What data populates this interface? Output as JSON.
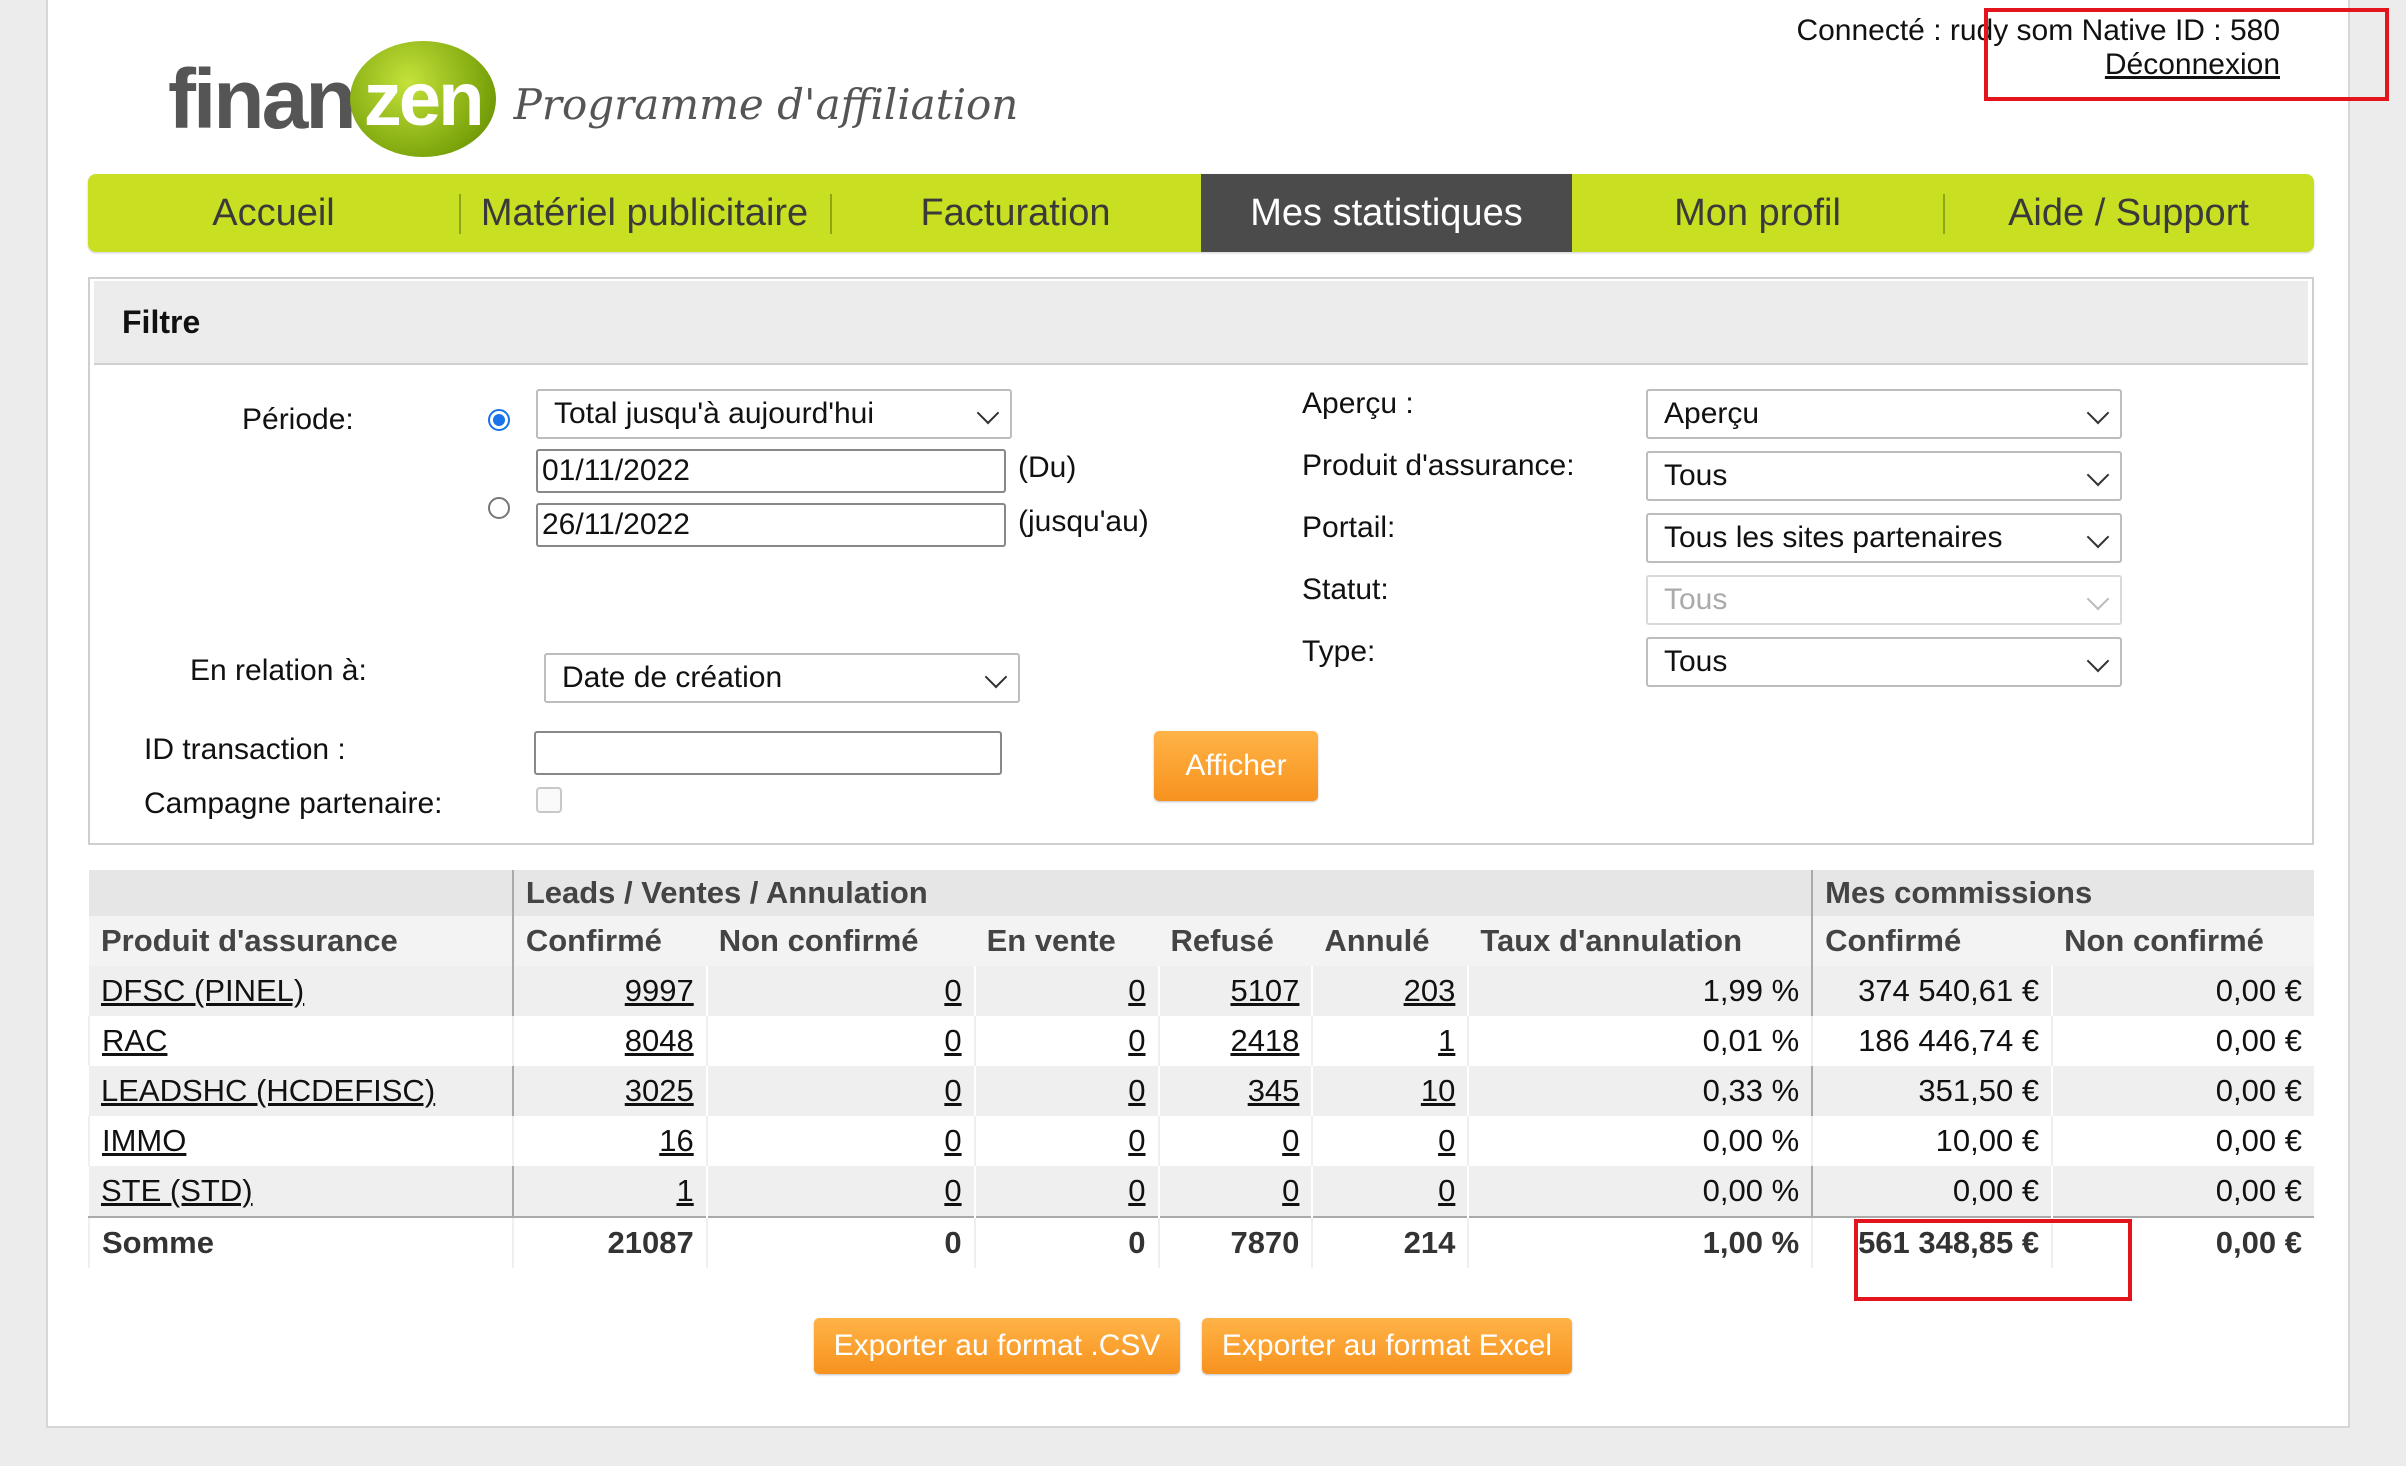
{
  "header": {
    "logo_finan": "finan",
    "logo_zen": "zen",
    "logo_subtitle": "Programme d'affiliation",
    "user_line": "Connecté : rudy som Native ID : 580",
    "logout": "Déconnexion"
  },
  "nav": {
    "items": [
      {
        "label": "Accueil"
      },
      {
        "label": "Matériel publicitaire"
      },
      {
        "label": "Facturation"
      },
      {
        "label": "Mes statistiques"
      },
      {
        "label": "Mon profil"
      },
      {
        "label": "Aide / Support"
      }
    ],
    "active_index": 3
  },
  "filter": {
    "title": "Filtre",
    "periode_label": "Période:",
    "periode_select": "Total jusqu'à aujourd'hui",
    "date_from": "01/11/2022",
    "date_from_suffix": "(Du)",
    "date_to": "26/11/2022",
    "date_to_suffix": "(jusqu'au)",
    "relation_label": "En relation à:",
    "relation_select": "Date de création",
    "transaction_label": "ID transaction :",
    "transaction_value": "",
    "campagne_label": "Campagne partenaire:",
    "apercu_label": "Aperçu :",
    "apercu_select": "Aperçu",
    "produit_label": "Produit d'assurance:",
    "produit_select": "Tous",
    "portail_label": "Portail:",
    "portail_select": "Tous les sites partenaires",
    "statut_label": "Statut:",
    "statut_select": "Tous",
    "type_label": "Type:",
    "type_select": "Tous",
    "submit": "Afficher"
  },
  "table": {
    "group_leads": "Leads / Ventes / Annulation",
    "group_commissions": "Mes commissions",
    "columns": [
      "Produit d'assurance",
      "Confirmé",
      "Non confirmé",
      "En vente",
      "Refusé",
      "Annulé",
      "Taux d'annulation",
      "Confirmé",
      "Non confirmé"
    ],
    "rows": [
      {
        "produit": "DFSC (PINEL)",
        "confirme": "9997",
        "non_confirme": "0",
        "en_vente": "0",
        "refuse": "5107",
        "annule": "203",
        "taux": "1,99 %",
        "comm_confirme": "374 540,61 €",
        "comm_non_confirme": "0,00 €"
      },
      {
        "produit": "RAC",
        "confirme": "8048",
        "non_confirme": "0",
        "en_vente": "0",
        "refuse": "2418",
        "annule": "1",
        "taux": "0,01 %",
        "comm_confirme": "186 446,74 €",
        "comm_non_confirme": "0,00 €"
      },
      {
        "produit": "LEADSHC (HCDEFISC)",
        "confirme": "3025",
        "non_confirme": "0",
        "en_vente": "0",
        "refuse": "345",
        "annule": "10",
        "taux": "0,33 %",
        "comm_confirme": "351,50 €",
        "comm_non_confirme": "0,00 €"
      },
      {
        "produit": "IMMO",
        "confirme": "16",
        "non_confirme": "0",
        "en_vente": "0",
        "refuse": "0",
        "annule": "0",
        "taux": "0,00 %",
        "comm_confirme": "10,00 €",
        "comm_non_confirme": "0,00 €"
      },
      {
        "produit": "STE (STD)",
        "confirme": "1",
        "non_confirme": "0",
        "en_vente": "0",
        "refuse": "0",
        "annule": "0",
        "taux": "0,00 %",
        "comm_confirme": "0,00 €",
        "comm_non_confirme": "0,00 €"
      }
    ],
    "sum": {
      "label": "Somme",
      "confirme": "21087",
      "non_confirme": "0",
      "en_vente": "0",
      "refuse": "7870",
      "annule": "214",
      "taux": "1,00 %",
      "comm_confirme": "561 348,85 €",
      "comm_non_confirme": "0,00 €"
    }
  },
  "export": {
    "csv": "Exporter au format .CSV",
    "excel": "Exporter au format Excel"
  },
  "colors": {
    "nav_green": "#c8e021",
    "nav_active": "#4b4b4b",
    "button_orange": "#f7921e",
    "highlight_red": "#e3141b",
    "radio_blue": "#1a73e8"
  }
}
